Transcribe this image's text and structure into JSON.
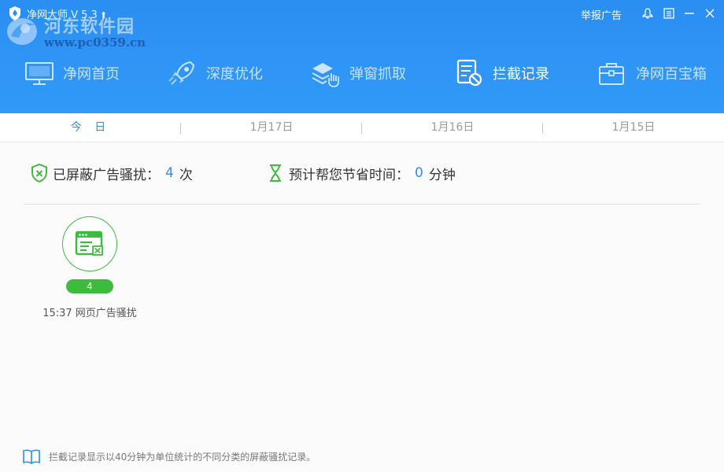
{
  "titlebar": {
    "app_title": "净网大师 V 5.3",
    "update_icon": "up-arrow-icon",
    "report_label": "举报广告",
    "watermark_text": "河东软件园",
    "watermark_url": "www.pc0359.cn",
    "controls": [
      "skin-icon",
      "menu-icon",
      "minimize-icon",
      "close-icon"
    ]
  },
  "nav": {
    "items": [
      {
        "label": "净网首页",
        "icon": "monitor-icon"
      },
      {
        "label": "深度优化",
        "icon": "rocket-icon"
      },
      {
        "label": "弹窗抓取",
        "icon": "layers-hand-icon"
      },
      {
        "label": "拦截记录",
        "icon": "block-record-icon",
        "active": true
      },
      {
        "label": "净网百宝箱",
        "icon": "toolbox-icon"
      }
    ]
  },
  "date_tabs": [
    "今 日",
    "1月17日",
    "1月16日",
    "1月15日"
  ],
  "stats": {
    "blocked_label": "已屏蔽广告骚扰：",
    "blocked_count": "4",
    "blocked_unit": "次",
    "saved_label": "预计帮您节省时间：",
    "saved_value": "0",
    "saved_unit": "分钟"
  },
  "records": [
    {
      "count": "4",
      "label": "15:37 网页广告骚扰",
      "icon": "webpage-ad-icon"
    }
  ],
  "footer": {
    "note": "拦截记录显示以40分钟为单位统计的不同分类的屏蔽骚扰记录。",
    "icon": "book-icon"
  },
  "colors": {
    "header_blue": "#2f95f6",
    "accent_blue": "#2a8ef2",
    "green": "#3dbb3d"
  }
}
